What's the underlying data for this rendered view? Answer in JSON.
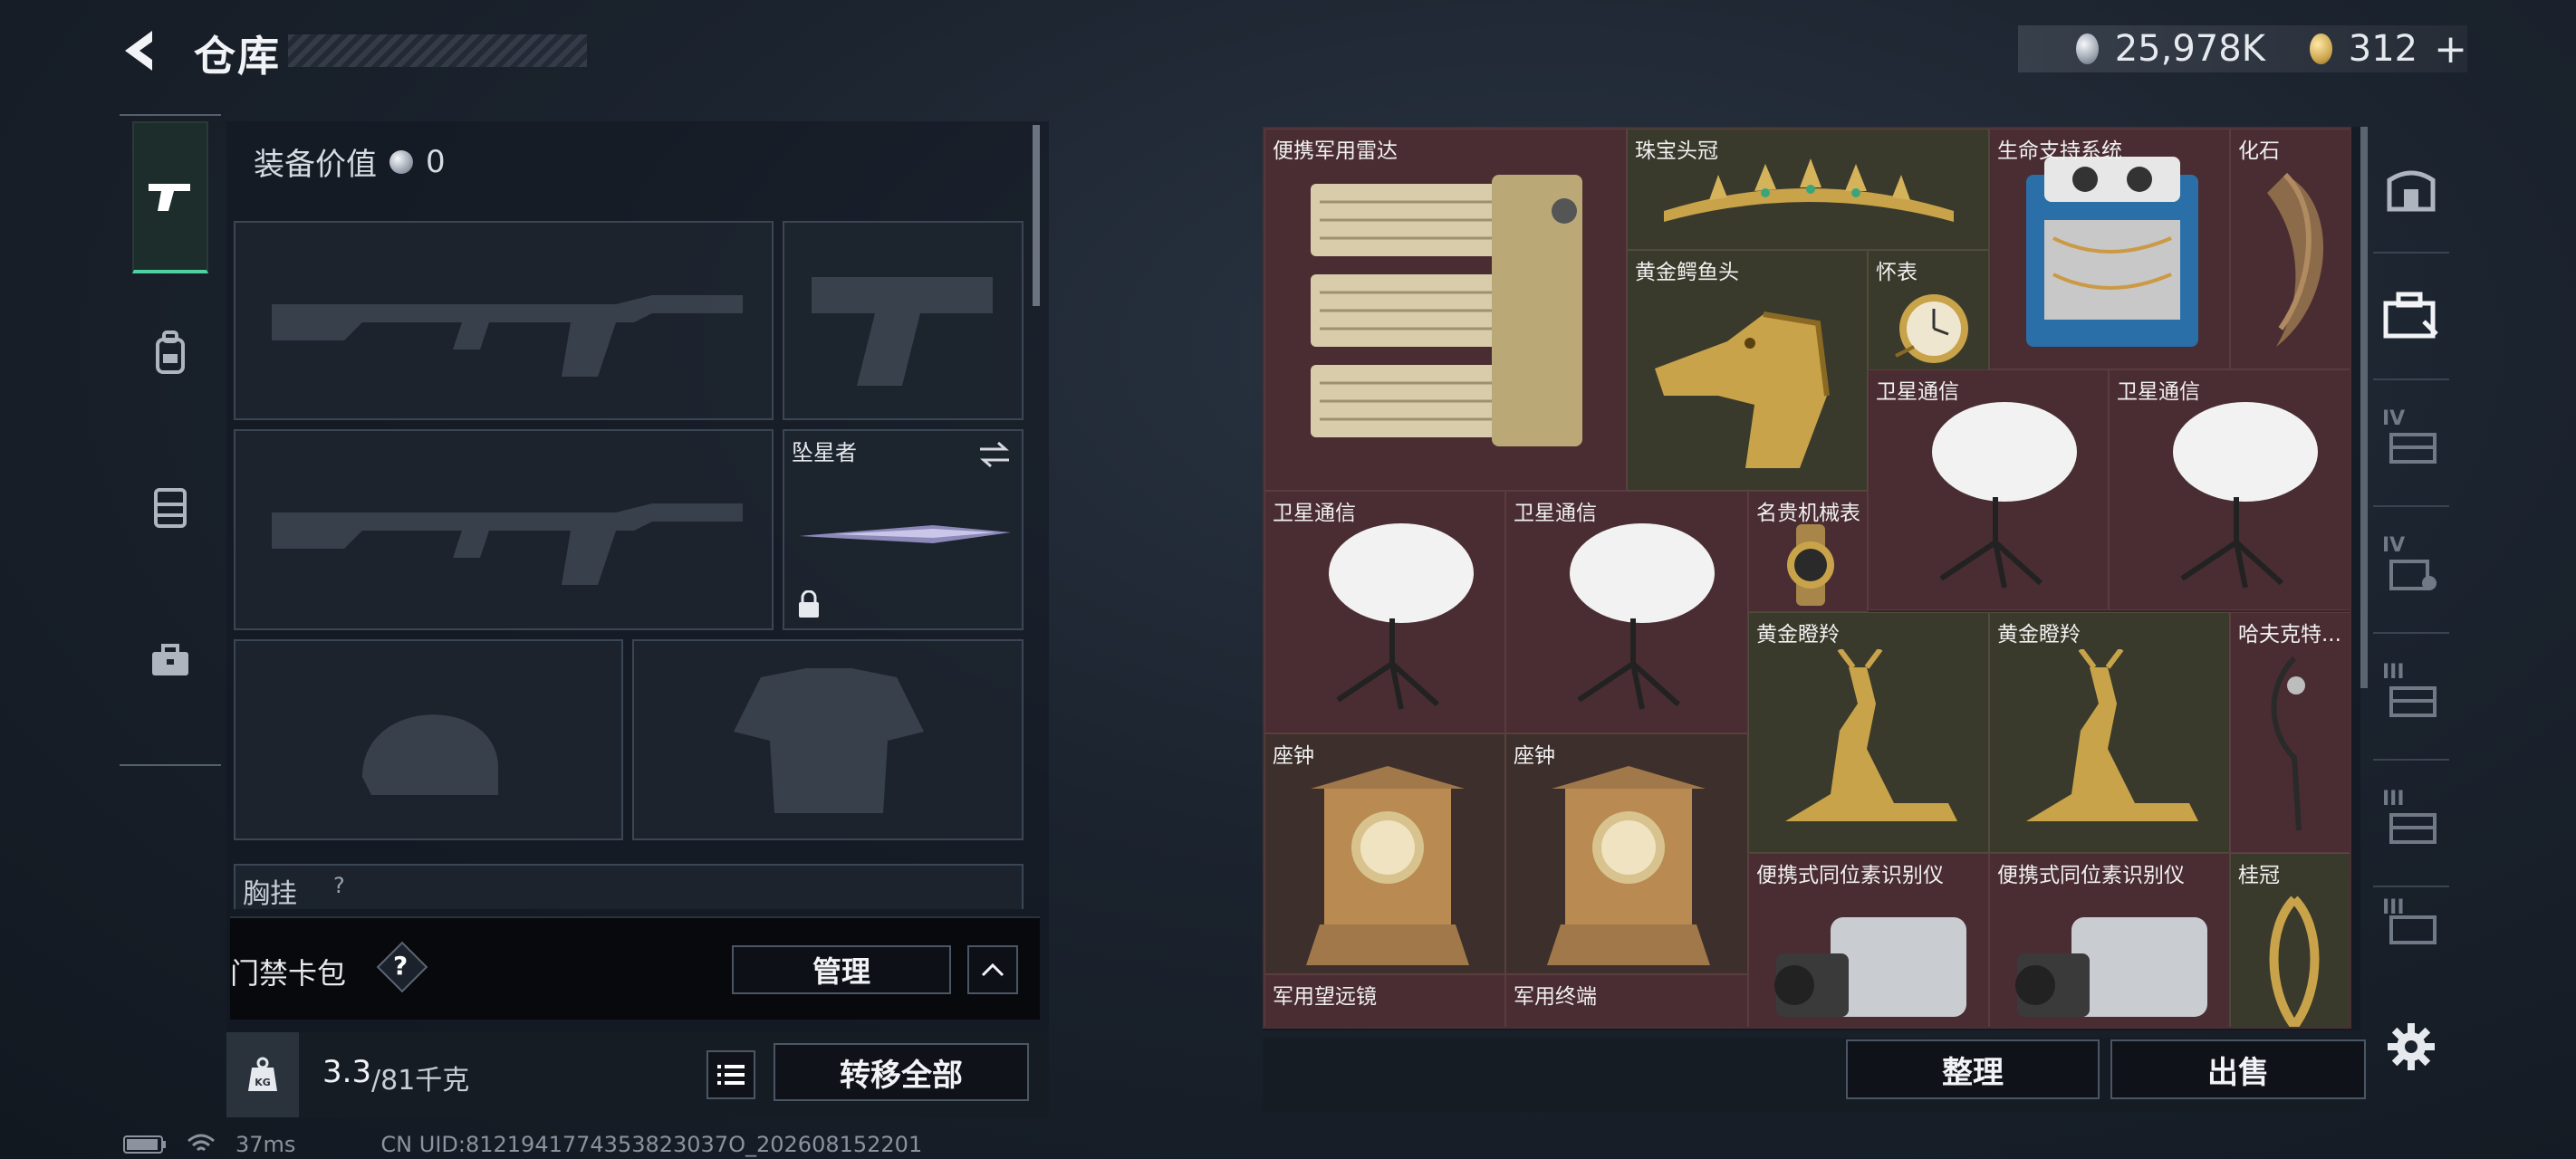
{
  "header": {
    "title": "仓库",
    "silver_amount": "25,978K",
    "gold_amount": "312",
    "gold_add": "+"
  },
  "categories": [
    {
      "icon": "pistol-icon",
      "active": true
    },
    {
      "icon": "backpack-icon",
      "active": false
    },
    {
      "icon": "vest-icon",
      "active": false
    },
    {
      "icon": "toolbox-icon",
      "active": false
    }
  ],
  "equipment": {
    "value_label": "装备价值",
    "value": "0",
    "melee_name": "坠星者",
    "vest_label": "胸挂",
    "vest_hint": "?"
  },
  "keycard": {
    "label": "门禁卡包",
    "help": "?",
    "manage": "管理"
  },
  "weight": {
    "current": "3.3",
    "max": "/81千克",
    "kg_icon_text": "KG",
    "transfer_all": "转移全部"
  },
  "inventory": {
    "items": [
      {
        "name": "便携军用雷达"
      },
      {
        "name": "珠宝头冠"
      },
      {
        "name": "生命支持系统"
      },
      {
        "name": "化石"
      },
      {
        "name": "黄金鳄鱼头"
      },
      {
        "name": "怀表"
      },
      {
        "name": "卫星通信"
      },
      {
        "name": "卫星通信"
      },
      {
        "name": "卫星通信"
      },
      {
        "name": "卫星通信"
      },
      {
        "name": "名贵机械表"
      },
      {
        "name": "黄金瞪羚"
      },
      {
        "name": "黄金瞪羚"
      },
      {
        "name": "哈夫克特..."
      },
      {
        "name": "座钟"
      },
      {
        "name": "座钟"
      },
      {
        "name": "便携式同位素识别仪"
      },
      {
        "name": "便携式同位素识别仪"
      },
      {
        "name": "桂冠"
      },
      {
        "name": "军用望远镜"
      },
      {
        "name": "军用终端"
      }
    ],
    "sort_label": "整理",
    "sell_label": "出售"
  },
  "side_tabs": [
    {
      "icon": "safe-box-icon",
      "roman": ""
    },
    {
      "icon": "case-icon",
      "roman": ""
    },
    {
      "icon": "storage-iv-icon",
      "roman": "IV"
    },
    {
      "icon": "storage-iv-lock-icon",
      "roman": "IV"
    },
    {
      "icon": "storage-iii-icon",
      "roman": "III"
    },
    {
      "icon": "storage-iii-icon",
      "roman": "III"
    },
    {
      "icon": "storage-iii-icon",
      "roman": "III"
    }
  ],
  "status": {
    "ping": "37ms",
    "uid": "CN UID:8121941774353823037O_202608152201"
  },
  "colors": {
    "accent_green": "#4fd1a1",
    "item_bg_red": "#4a2d32",
    "item_bg_gold": "#3a3a2c"
  }
}
